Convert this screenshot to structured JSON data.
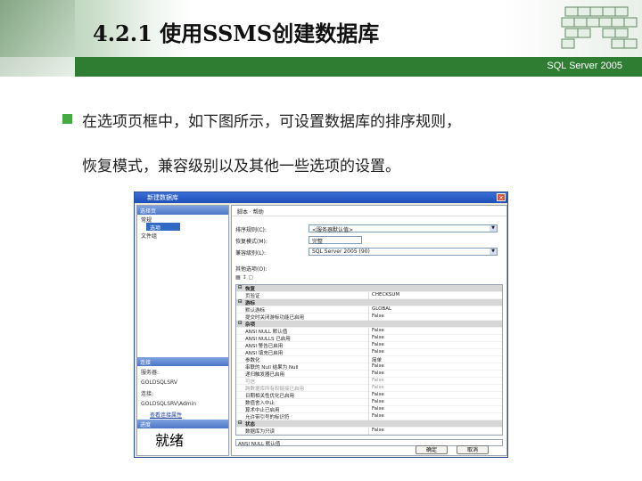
{
  "slide": {
    "title": "4.2.1  使用SSMS创建数据库",
    "subtitle": "SQL Server 2005",
    "bullet_line1": "在选项页框中，如下图所示，可设置数据库的排序规则，",
    "bullet_line2": "恢复模式，兼容级别以及其他一些选项的设置。"
  },
  "dialog": {
    "title": "新建数据库",
    "pages_header": "选择页",
    "pages": [
      "常规",
      "选项",
      "文件组"
    ],
    "toolbar": "脚本 · 帮助",
    "collation_label": "排序规则(C):",
    "collation_value": "<服务器默认值>",
    "recovery_label": "恢复模式(M):",
    "recovery_value": "完整",
    "compat_label": "兼容级别(L):",
    "compat_value": "SQL Server 2005 (90)",
    "other_label": "其他选项(O):",
    "connection_header": "连接",
    "server_label": "服务器:",
    "server_value": "GOLDSQLSRV",
    "conn_label": "连接:",
    "conn_value": "GOLDSQLSRV\\Admin",
    "conn_link": "查看连接属性",
    "progress_header": "进度",
    "progress_value": "就绪",
    "desc_text": "ANSI NULL 默认值",
    "ok_label": "确定",
    "cancel_label": "取消",
    "grid": [
      {
        "cat": true,
        "k": "恢复",
        "v": ""
      },
      {
        "k": "页验证",
        "v": "CHECKSUM"
      },
      {
        "cat": true,
        "k": "游标",
        "v": ""
      },
      {
        "k": "默认游标",
        "v": "GLOBAL"
      },
      {
        "k": "提交时关闭游标功能已启用",
        "v": "False"
      },
      {
        "cat": true,
        "k": "杂项",
        "v": ""
      },
      {
        "k": "ANSI NULL 默认值",
        "v": "False"
      },
      {
        "k": "ANSI NULLS 已启用",
        "v": "False"
      },
      {
        "k": "ANSI 警告已启用",
        "v": "False"
      },
      {
        "k": "ANSI 填充已启用",
        "v": "False"
      },
      {
        "k": "参数化",
        "v": "简单"
      },
      {
        "k": "串联的 Null 结果为 Null",
        "v": "False"
      },
      {
        "k": "递归触发器已启用",
        "v": "False"
      },
      {
        "dim": true,
        "k": "可信",
        "v": "False"
      },
      {
        "dim": true,
        "k": "跨数据库所有权链接已启用",
        "v": "False"
      },
      {
        "k": "日期相关性优化已启用",
        "v": "False"
      },
      {
        "k": "数值舍入中止",
        "v": "False"
      },
      {
        "k": "算术中止已启用",
        "v": "False"
      },
      {
        "k": "允许带引号的标识符",
        "v": "False"
      },
      {
        "cat": true,
        "k": "状态",
        "v": ""
      },
      {
        "k": "数据库为只读",
        "v": "False"
      },
      {
        "dim": true,
        "k": "数据库状态",
        "v": "Normal"
      },
      {
        "k": "限制访问",
        "v": "MULTI_USER"
      }
    ]
  },
  "colors": {
    "band": "#2e7d32",
    "bullet": "#44aa44",
    "selection": "#316ac5"
  }
}
